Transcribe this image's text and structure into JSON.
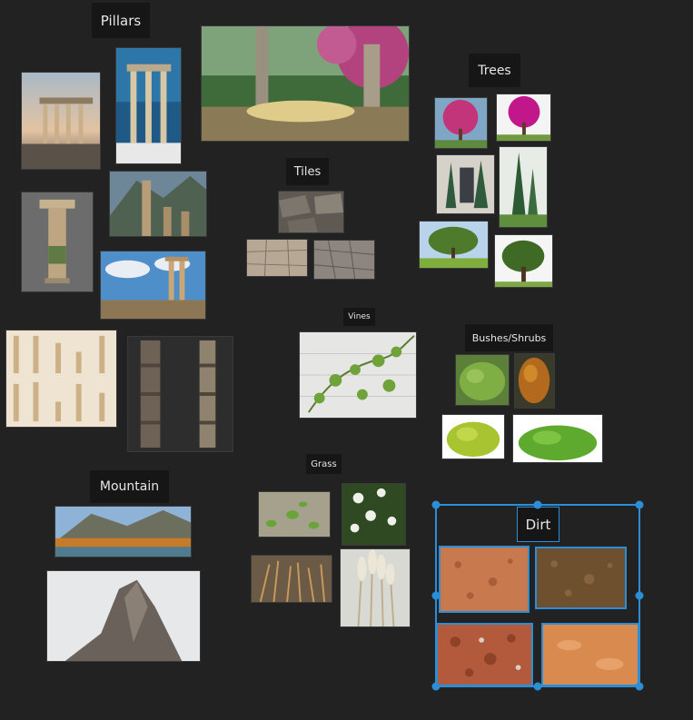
{
  "board": {
    "background": "#222222",
    "selection_color": "#2b8ed6"
  },
  "labels": {
    "pillars": "Pillars",
    "trees": "Trees",
    "tiles": "Tiles",
    "vines": "Vines",
    "bushes": "Bushes/Shrubs",
    "mountain": "Mountain",
    "grass": "Grass",
    "dirt": "Dirt"
  }
}
